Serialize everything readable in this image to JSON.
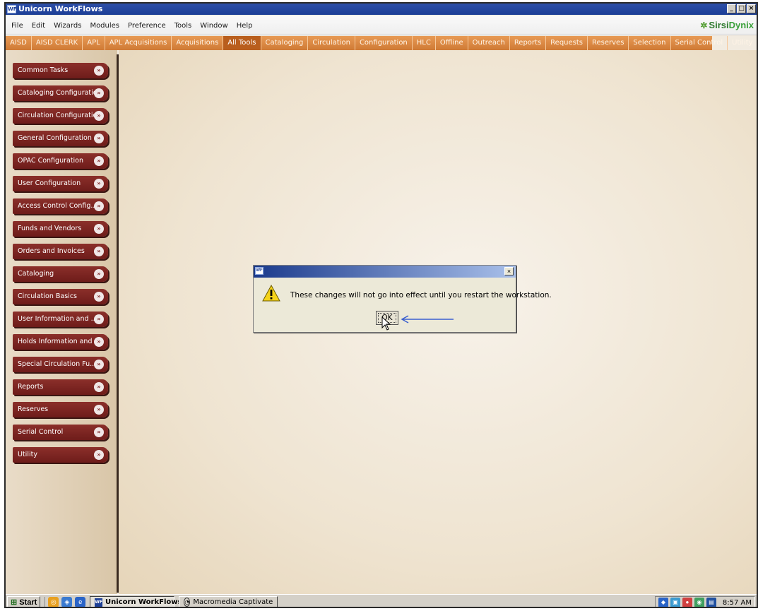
{
  "window": {
    "title": "Unicorn WorkFlows",
    "icon_text": "WF",
    "controls": [
      "_",
      "□",
      "×"
    ]
  },
  "menubar": {
    "items": [
      "File",
      "Edit",
      "Wizards",
      "Modules",
      "Preference",
      "Tools",
      "Window",
      "Help"
    ],
    "brand_part1": "Sirsi",
    "brand_part2": "Dynix"
  },
  "toolbar": {
    "tabs": [
      "AISD",
      "AISD CLERK",
      "APL",
      "APL Acquisitions",
      "Acquisitions",
      "All Tools",
      "Cataloging",
      "Circulation",
      "Configuration",
      "HLC",
      "Offline",
      "Outreach",
      "Reports",
      "Requests",
      "Reserves",
      "Selection",
      "Serial Control",
      "Utility"
    ],
    "active": "All Tools"
  },
  "sidebar": {
    "items": [
      "Common Tasks",
      "Cataloging Configuration",
      "Circulation Configuration",
      "General Configuration",
      "OPAC Configuration",
      "User Configuration",
      "Access Control Config...",
      "Funds and Vendors",
      "Orders and Invoices",
      "Cataloging",
      "Circulation Basics",
      "User Information and ...",
      "Holds Information and ...",
      "Special Circulation Fu...",
      "Reports",
      "Reserves",
      "Serial Control",
      "Utility"
    ]
  },
  "dialog": {
    "icon_text": "WF",
    "close": "×",
    "message": "These changes will not go into effect until you restart the workstation.",
    "ok_label": "OK"
  },
  "taskbar": {
    "start_label": "Start",
    "tasks": [
      "Unicorn WorkFlows",
      "Macromedia Captivate"
    ],
    "clock": "8:57 AM"
  }
}
